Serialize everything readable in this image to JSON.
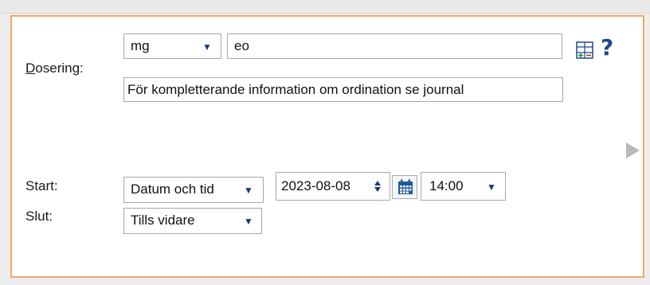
{
  "dosage": {
    "label_first": "D",
    "label_rest": "osering:",
    "unit": "mg",
    "amount": "eo",
    "info": "För kompletterande information om ordination se journal"
  },
  "start": {
    "label": "Start:",
    "mode": "Datum och tid",
    "date": "2023-08-08",
    "time": "14:00"
  },
  "end": {
    "label": "Slut:",
    "mode": "Tills vidare"
  },
  "icons": {
    "help": "?",
    "dropdown": "▼",
    "table": "table-icon",
    "calendar": "calendar-icon",
    "next": "play-arrow-icon"
  },
  "colors": {
    "panel_border": "#f0a868",
    "accent": "#1b3b78"
  }
}
